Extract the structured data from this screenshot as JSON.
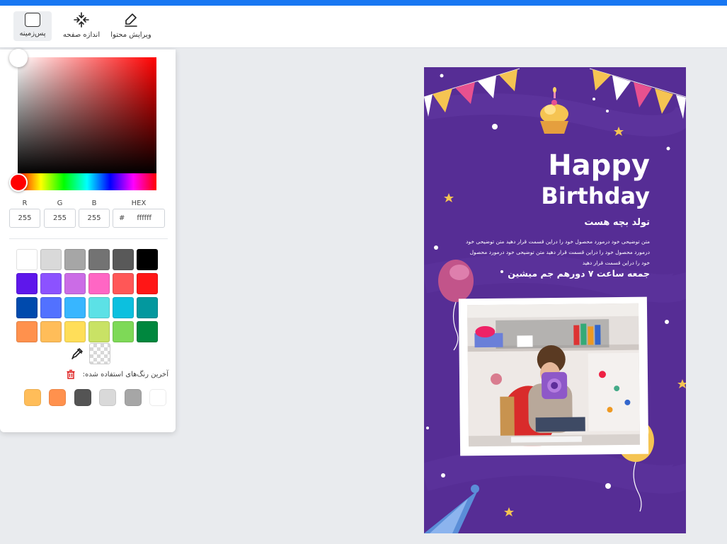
{
  "toolbar": {
    "background_label": "پس‌زمینه",
    "page_size_label": "اندازه صفحه",
    "edit_content_label": "ویرایش محتوا"
  },
  "color_picker": {
    "current_hex": "#ff0000",
    "fields": {
      "r_label": "R",
      "g_label": "G",
      "b_label": "B",
      "hex_label": "HEX",
      "r_value": "255",
      "g_value": "255",
      "b_value": "255",
      "hex_prefix": "#",
      "hex_value": "ffffff"
    },
    "palette": [
      "#ffffff",
      "#d9d9d9",
      "#a6a6a6",
      "#737373",
      "#595959",
      "#000000",
      "#5e17eb",
      "#8c52ff",
      "#cb6ce6",
      "#ff66c4",
      "#ff5757",
      "#ff1616",
      "#004aad",
      "#5271ff",
      "#38b6ff",
      "#5ce1e6",
      "#0cc0df",
      "#03989e",
      "#ff914d",
      "#ffbd59",
      "#ffde59",
      "#c9e265",
      "#7ed957",
      "#00873e"
    ],
    "recent_title": "آخرین رنگ‌های استفاده شده:",
    "recent": [
      "#ffffff",
      "#a6a6a6",
      "#d9d9d9",
      "#545454",
      "#ff914d",
      "#ffbd59"
    ]
  },
  "design": {
    "background_color": "#562d95",
    "happy": "Happy",
    "birthday": "Birthday",
    "title": "تولد بچه هست",
    "body": "متن توضیحی خود درمورد محصول خود را دراین قسمت قرار دهید متن توضیحی خود درمورد محصول خود را دراین قسمت قرار دهید متن توضیحی خود درمورد محصول خود را دراین قسمت قرار دهید",
    "date_line": "جمعه ساعت ۷ دورهم جم میشین"
  },
  "icons": {
    "background": "square-outline-icon",
    "page_size": "resize-arrows-icon",
    "edit_content": "pencil-icon",
    "eyedropper": "eyedropper-icon",
    "clear_recent": "trash-icon"
  }
}
